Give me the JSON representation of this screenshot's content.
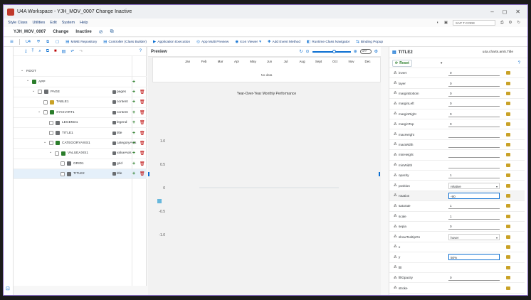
{
  "window": {
    "title": "U4A Workspace - YJH_MOV_0007 Change Inactive",
    "controls": [
      "–",
      "◻",
      "⟳",
      "⤢",
      "✕"
    ]
  },
  "menu": {
    "items": [
      "Style Class",
      "Utilities",
      "Edit",
      "System",
      "Help"
    ],
    "tcode_placeholder": "SAP T-CODE"
  },
  "header": {
    "app_id": "YJH_MOV_0007",
    "mode": "Change",
    "status": "Inactive"
  },
  "toolbar": {
    "items": [
      "MIME Repository",
      "Controller (Class Builder)",
      "Application Execution",
      "App Multi Preview",
      "Icon Viewer",
      "Add Event Method",
      "Runtime Class Navigator",
      "Binding Popup"
    ]
  },
  "tree": {
    "rows": [
      {
        "label": "ROOT",
        "agg": "",
        "level": 0,
        "cb": false,
        "icon": "",
        "add": false,
        "del": false
      },
      {
        "label": "APP",
        "agg": "",
        "level": 1,
        "cb": false,
        "icon": "#2b7d2b",
        "add": true,
        "del": false
      },
      {
        "label": "PAGE",
        "agg": "pages",
        "level": 2,
        "cb": true,
        "icon": "#6a6d70",
        "add": true,
        "del": true
      },
      {
        "label": "TABLE1",
        "agg": "content",
        "level": 3,
        "cb": true,
        "icon": "#c9a227",
        "add": true,
        "del": true
      },
      {
        "label": "XYCHART1",
        "agg": "content",
        "level": 3,
        "cb": true,
        "icon": "#2b7d2b",
        "add": true,
        "del": true
      },
      {
        "label": "LEGEND1",
        "agg": "legend",
        "level": 4,
        "cb": true,
        "icon": "#6a6d70",
        "add": true,
        "del": true
      },
      {
        "label": "TITLE1",
        "agg": "title",
        "level": 4,
        "cb": true,
        "icon": "#6a6d70",
        "add": true,
        "del": true
      },
      {
        "label": "CATEGORYAXIS1",
        "agg": "categoryAxis",
        "level": 4,
        "cb": true,
        "icon": "#2b7d2b",
        "add": true,
        "del": true
      },
      {
        "label": "VALUEAXIS1",
        "agg": "valueAxis",
        "level": 5,
        "cb": true,
        "icon": "#2b7d2b",
        "add": true,
        "del": true
      },
      {
        "label": "GRID1",
        "agg": "grid",
        "level": 6,
        "cb": true,
        "icon": "#6a6d70",
        "add": true,
        "del": true
      },
      {
        "label": "TITLE2",
        "agg": "title",
        "level": 6,
        "cb": true,
        "icon": "#6a6d70",
        "add": true,
        "del": true,
        "selected": true
      }
    ]
  },
  "preview": {
    "title": "Preview",
    "toggle": "OFF",
    "months": [
      "Jan",
      "Feb",
      "Mar",
      "Apr",
      "May",
      "Jun",
      "Jul",
      "Aug",
      "Sept",
      "Oct",
      "Nov",
      "Dec"
    ],
    "no_data": "No data",
    "chart_title": "Year-Over-Year Monthly Performance",
    "y_ticks": [
      "1.0",
      "0.5",
      "0",
      "-0.5",
      "-1.0"
    ]
  },
  "props": {
    "title": "TITLE2",
    "class": "u4a.charts.am5.Title",
    "reset_label": "Reset",
    "rows": [
      {
        "name": "invert",
        "value": "0",
        "type": "input"
      },
      {
        "name": "layer",
        "value": "0",
        "type": "input"
      },
      {
        "name": "marginBottom",
        "value": "0",
        "type": "input"
      },
      {
        "name": "marginLeft",
        "value": "0",
        "type": "input"
      },
      {
        "name": "marginRight",
        "value": "0",
        "type": "input"
      },
      {
        "name": "marginTop",
        "value": "0",
        "type": "input"
      },
      {
        "name": "maxHeight",
        "value": "",
        "type": "input"
      },
      {
        "name": "maxWidth",
        "value": "",
        "type": "input"
      },
      {
        "name": "minHeight",
        "value": "",
        "type": "input"
      },
      {
        "name": "minWidth",
        "value": "",
        "type": "input"
      },
      {
        "name": "opacity",
        "value": "1",
        "type": "input"
      },
      {
        "name": "position",
        "value": "relative",
        "type": "select"
      },
      {
        "name": "rotation",
        "value": "-90",
        "type": "edit",
        "hl": true
      },
      {
        "name": "saturate",
        "value": "1",
        "type": "input"
      },
      {
        "name": "scale",
        "value": "1",
        "type": "input"
      },
      {
        "name": "sepia",
        "value": "0",
        "type": "input"
      },
      {
        "name": "showTooltipOn",
        "value": "hover",
        "type": "select"
      },
      {
        "name": "x",
        "value": "",
        "type": "none"
      },
      {
        "name": "y",
        "value": "50%",
        "type": "edit"
      },
      {
        "name": "fill",
        "value": "",
        "type": "none"
      },
      {
        "name": "fillOpacity",
        "value": "0",
        "type": "input"
      },
      {
        "name": "stroke",
        "value": "",
        "type": "none"
      }
    ]
  }
}
